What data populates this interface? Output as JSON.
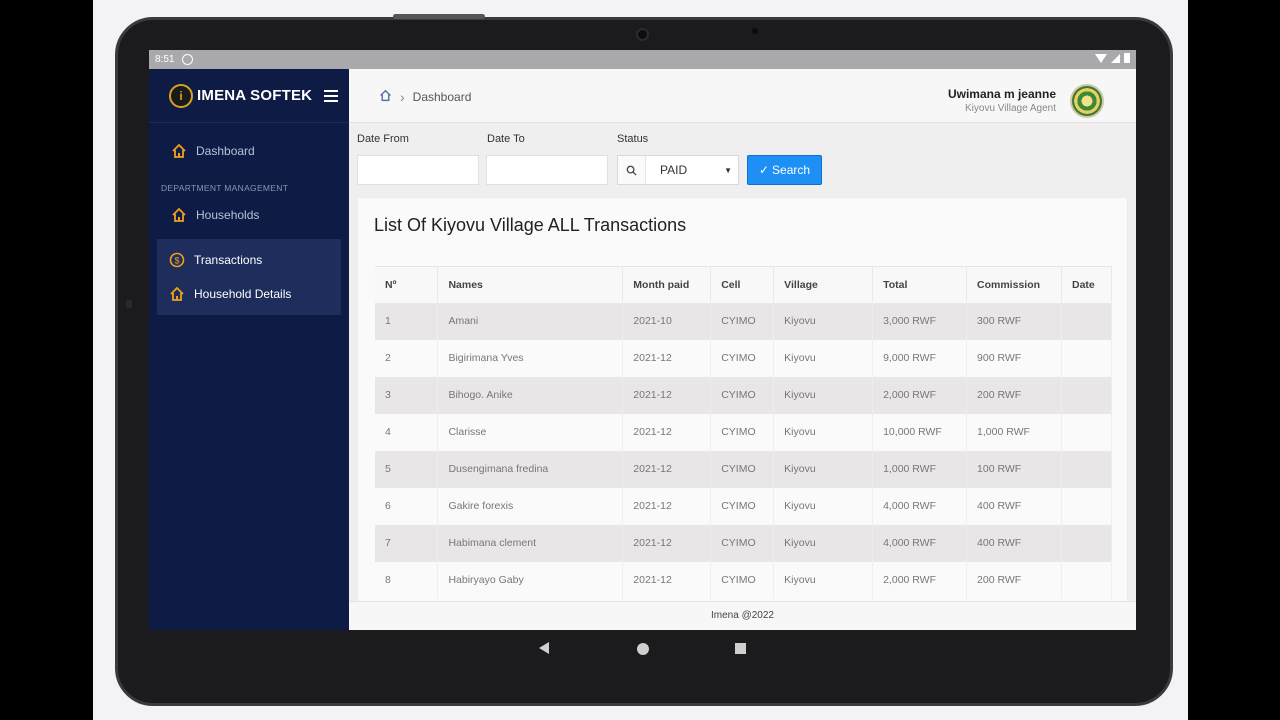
{
  "statusbar": {
    "time": "8:51"
  },
  "brand": {
    "name": "IMENA SOFTEK",
    "logo_letter": "i"
  },
  "sidebar": {
    "dashboard": "Dashboard",
    "section_title": "DEPARTMENT MANAGEMENT",
    "households": "Households",
    "transactions": "Transactions",
    "household_details": "Household Details"
  },
  "breadcrumb": {
    "current": "Dashboard"
  },
  "user": {
    "name": "Uwimana m jeanne",
    "role": "Kiyovu Village Agent"
  },
  "filters": {
    "date_from_label": "Date From",
    "date_to_label": "Date To",
    "status_label": "Status",
    "status_value": "PAID",
    "search_label": "Search"
  },
  "card": {
    "title": "List Of Kiyovu Village ALL Transactions"
  },
  "table": {
    "headers": [
      "Nº",
      "Names",
      "Month paid",
      "Cell",
      "Village",
      "Total",
      "Commission",
      "Date"
    ],
    "rows": [
      [
        "1",
        "Amani",
        "2021-10",
        "CYIMO",
        "Kiyovu",
        "3,000 RWF",
        "300 RWF",
        ""
      ],
      [
        "2",
        "Bigirimana Yves",
        "2021-12",
        "CYIMO",
        "Kiyovu",
        "9,000 RWF",
        "900 RWF",
        ""
      ],
      [
        "3",
        "Bihogo. Anike",
        "2021-12",
        "CYIMO",
        "Kiyovu",
        "2,000 RWF",
        "200 RWF",
        ""
      ],
      [
        "4",
        "Clarisse",
        "2021-12",
        "CYIMO",
        "Kiyovu",
        "10,000 RWF",
        "1,000 RWF",
        ""
      ],
      [
        "5",
        "Dusengimana fredina",
        "2021-12",
        "CYIMO",
        "Kiyovu",
        "1,000 RWF",
        "100 RWF",
        ""
      ],
      [
        "6",
        "Gakire forexis",
        "2021-12",
        "CYIMO",
        "Kiyovu",
        "4,000 RWF",
        "400 RWF",
        ""
      ],
      [
        "7",
        "Habimana clement",
        "2021-12",
        "CYIMO",
        "Kiyovu",
        "4,000 RWF",
        "400 RWF",
        ""
      ],
      [
        "8",
        "Habiryayo Gaby",
        "2021-12",
        "CYIMO",
        "Kiyovu",
        "2,000 RWF",
        "200 RWF",
        ""
      ]
    ]
  },
  "footer": {
    "text": "Imena @2022"
  },
  "colors": {
    "sidebar": "#0d1b45",
    "accent": "#1e90f5",
    "icon": "#f0a020"
  }
}
